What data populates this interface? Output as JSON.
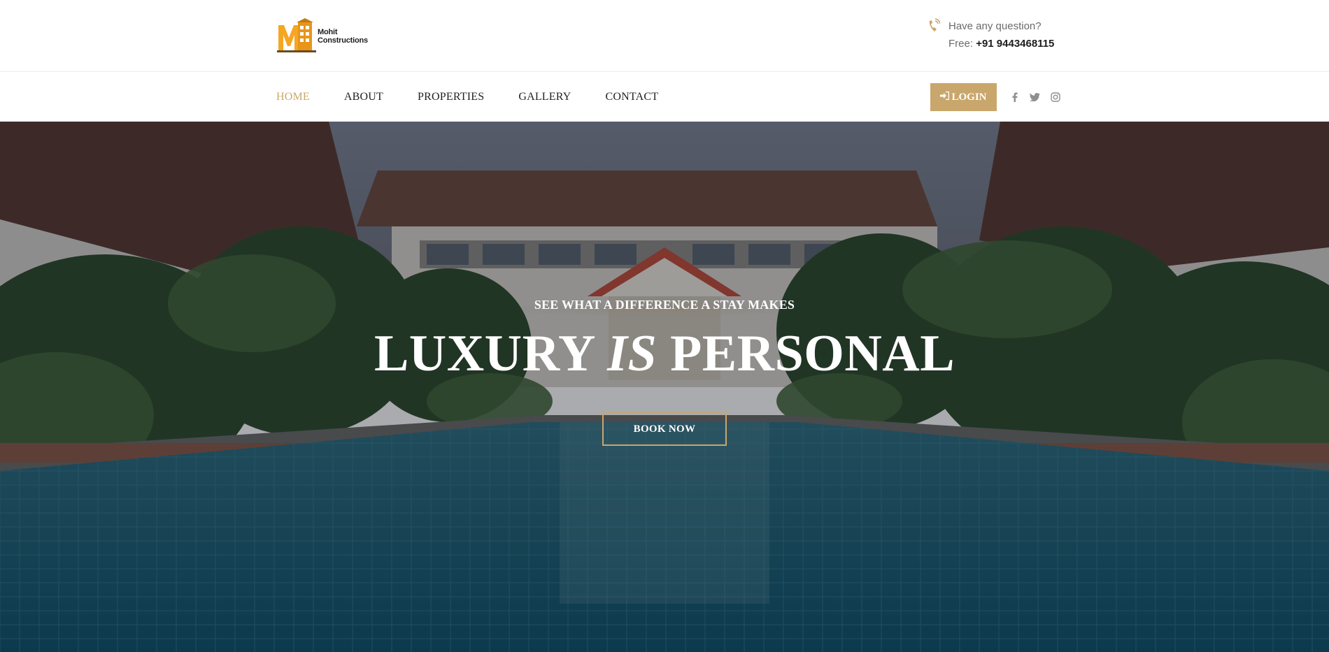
{
  "brand": {
    "line1": "Mohit",
    "line2": "Constructions",
    "colors": {
      "accent": "#c9a66b",
      "logo_orange": "#f5a623"
    }
  },
  "contact": {
    "icon": "phone-icon",
    "question": "Have any question?",
    "free_label": "Free:",
    "phone": "+91 9443468115"
  },
  "nav": {
    "items": [
      {
        "label": "HOME",
        "active": true
      },
      {
        "label": "ABOUT"
      },
      {
        "label": "PROPERTIES"
      },
      {
        "label": "GALLERY"
      },
      {
        "label": "CONTACT"
      }
    ],
    "login_label": "LOGIN",
    "login_icon": "sign-in-icon",
    "socials": [
      "facebook-icon",
      "twitter-icon",
      "instagram-icon"
    ]
  },
  "hero": {
    "subtitle": "SEE WHAT A DIFFERENCE A STAY MAKES",
    "title_part1": "LUXURY ",
    "title_italic": "IS",
    "title_part2": " PERSONAL",
    "button_label": "BOOK NOW"
  }
}
